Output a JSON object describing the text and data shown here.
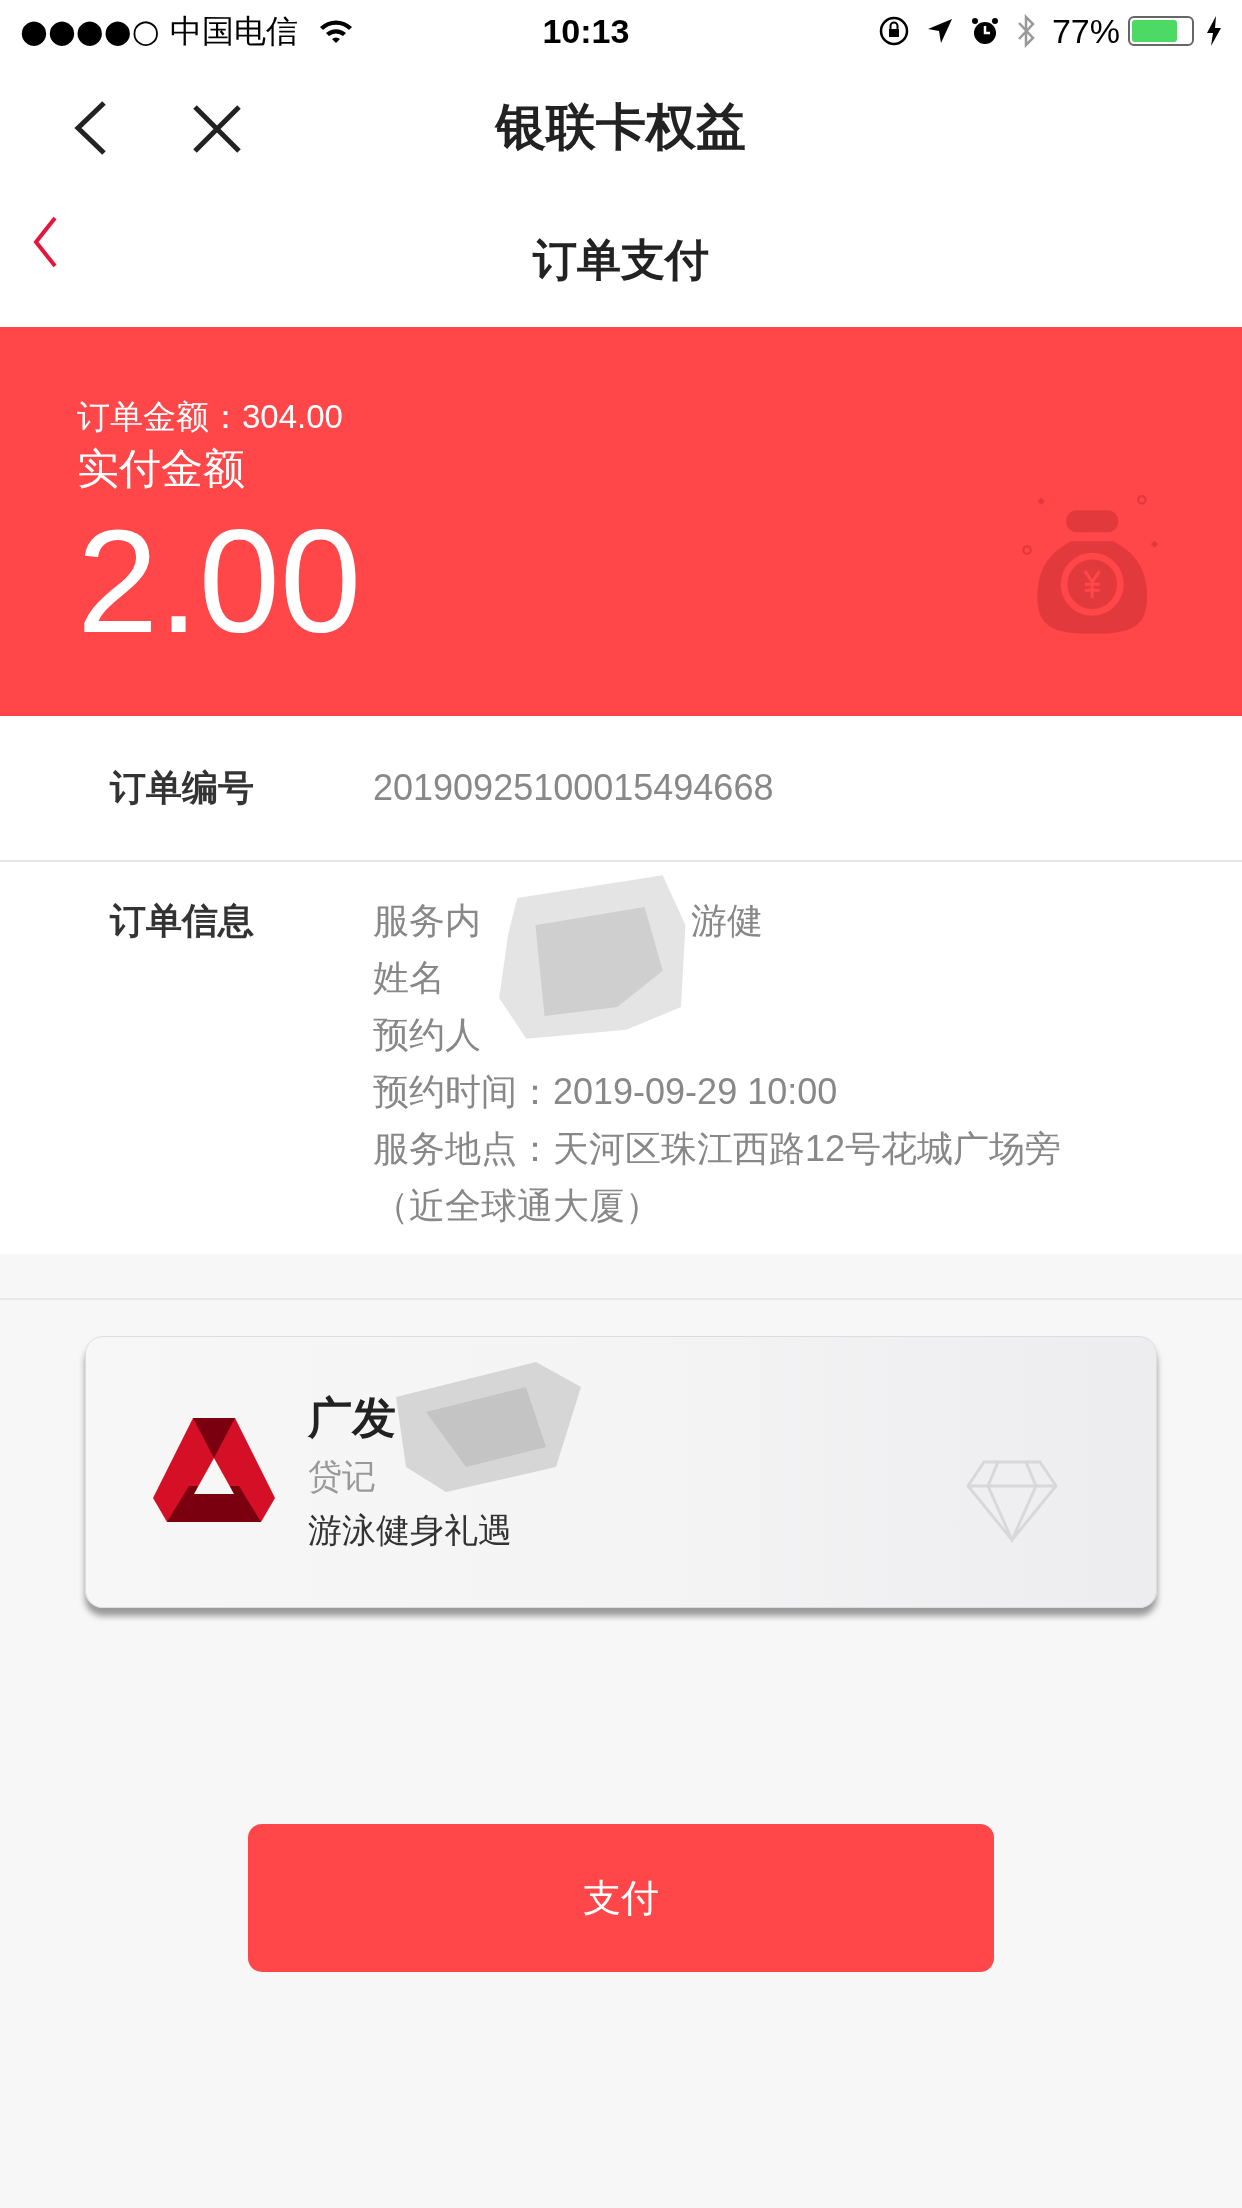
{
  "status_bar": {
    "carrier": "●●●●○ 中国电信",
    "time": "10:13",
    "battery": "77%"
  },
  "nav": {
    "title": "银联卡权益"
  },
  "header": {
    "title": "订单支付"
  },
  "amount": {
    "order_amount": "订单金额：304.00",
    "paid_label": "实付金额",
    "paid": "2.00"
  },
  "order_number": {
    "label": "订单编号",
    "value": "20190925100015494668"
  },
  "order_info": {
    "label": "订单信息",
    "lines": [
      {
        "parts": [
          "服务内",
          "游健"
        ]
      },
      {
        "parts": [
          "姓名"
        ]
      },
      {
        "parts": [
          "预约人"
        ]
      },
      {
        "parts": [
          "预约时间：2019-09-29 10:00"
        ]
      },
      {
        "parts": [
          "服务地点：天河区珠江西路12号花城广场旁"
        ]
      },
      {
        "parts": [
          "（近全球通大厦）"
        ]
      }
    ]
  },
  "card": {
    "name": "广发",
    "type": "贷记",
    "benefit": "游泳健身礼遇"
  },
  "pay_button": "支付"
}
